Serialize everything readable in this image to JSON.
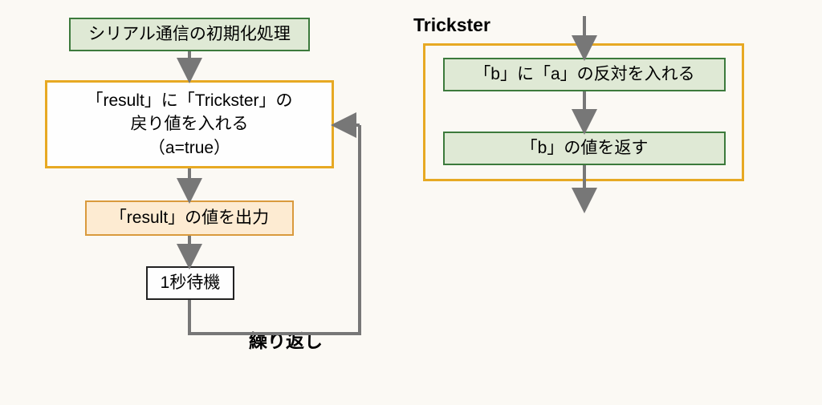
{
  "left": {
    "init": "シリアル通信の初期化処理",
    "assign": "「result」に「Trickster」の\n戻り値を入れる\n（a=true）",
    "output": "「result」の値を出力",
    "wait": "1秒待機",
    "loop_label": "繰り返し"
  },
  "right": {
    "title": "Trickster",
    "step1": "「b」に「a」の反対を入れる",
    "step2": "「b」の値を返す"
  }
}
